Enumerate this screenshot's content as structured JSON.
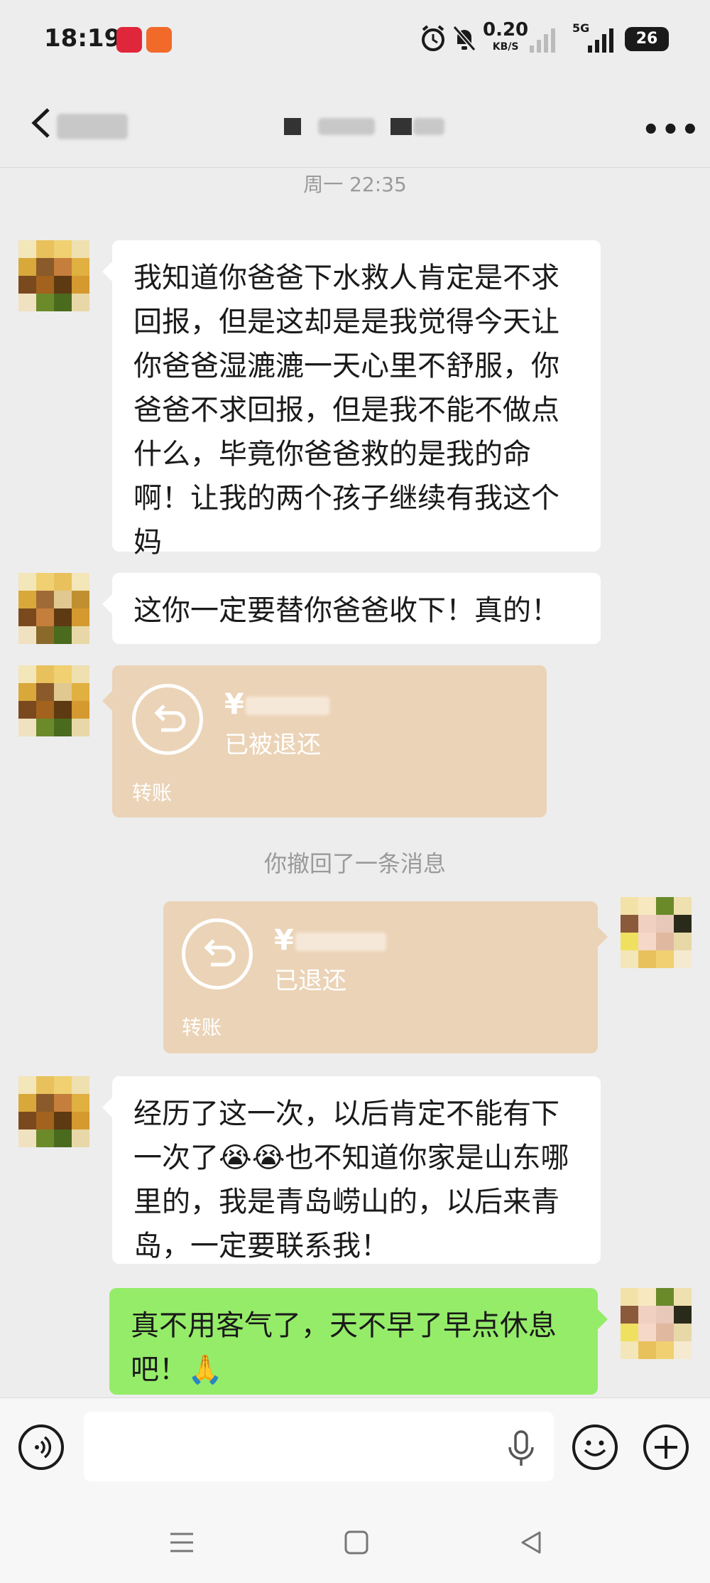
{
  "status_bar": {
    "time": "18:19",
    "net_speed_value": "0.20",
    "net_speed_unit": "KB/S",
    "network": "5G",
    "battery": "26"
  },
  "header": {
    "title": "",
    "more_icon": "•••"
  },
  "timestamp": "周一 22:35",
  "messages": [
    {
      "side": "left",
      "type": "text",
      "text": "我知道你爸爸下水救人肯定是不求回报，但是这却是是我觉得今天让你爸爸湿漉漉一天心里不舒服，你爸爸不求回报，但是我不能不做点什么，毕竟你爸爸救的是我的命啊！让我的两个孩子继续有我这个妈"
    },
    {
      "side": "left",
      "type": "text",
      "text": "这你一定要替你爸爸收下！真的！"
    },
    {
      "side": "left",
      "type": "transfer",
      "amount_prefix": "¥",
      "status": "已被退还",
      "label": "转账"
    },
    {
      "side": "right",
      "type": "transfer",
      "amount_prefix": "¥",
      "status": "已退还",
      "label": "转账"
    },
    {
      "side": "left",
      "type": "text",
      "text": "经历了这一次，以后肯定不能有下一次了😭😭也不知道你家是山东哪里的，我是青岛崂山的，以后来青岛，一定要联系我！"
    },
    {
      "side": "right",
      "type": "text",
      "text": "真不用客气了，天不早了早点休息吧！🙏"
    }
  ],
  "system_message": "你撤回了一条消息",
  "colors": {
    "background": "#ededed",
    "self_bubble": "#95ec69",
    "other_bubble": "#ffffff",
    "transfer_card": "#ebd3b7"
  }
}
